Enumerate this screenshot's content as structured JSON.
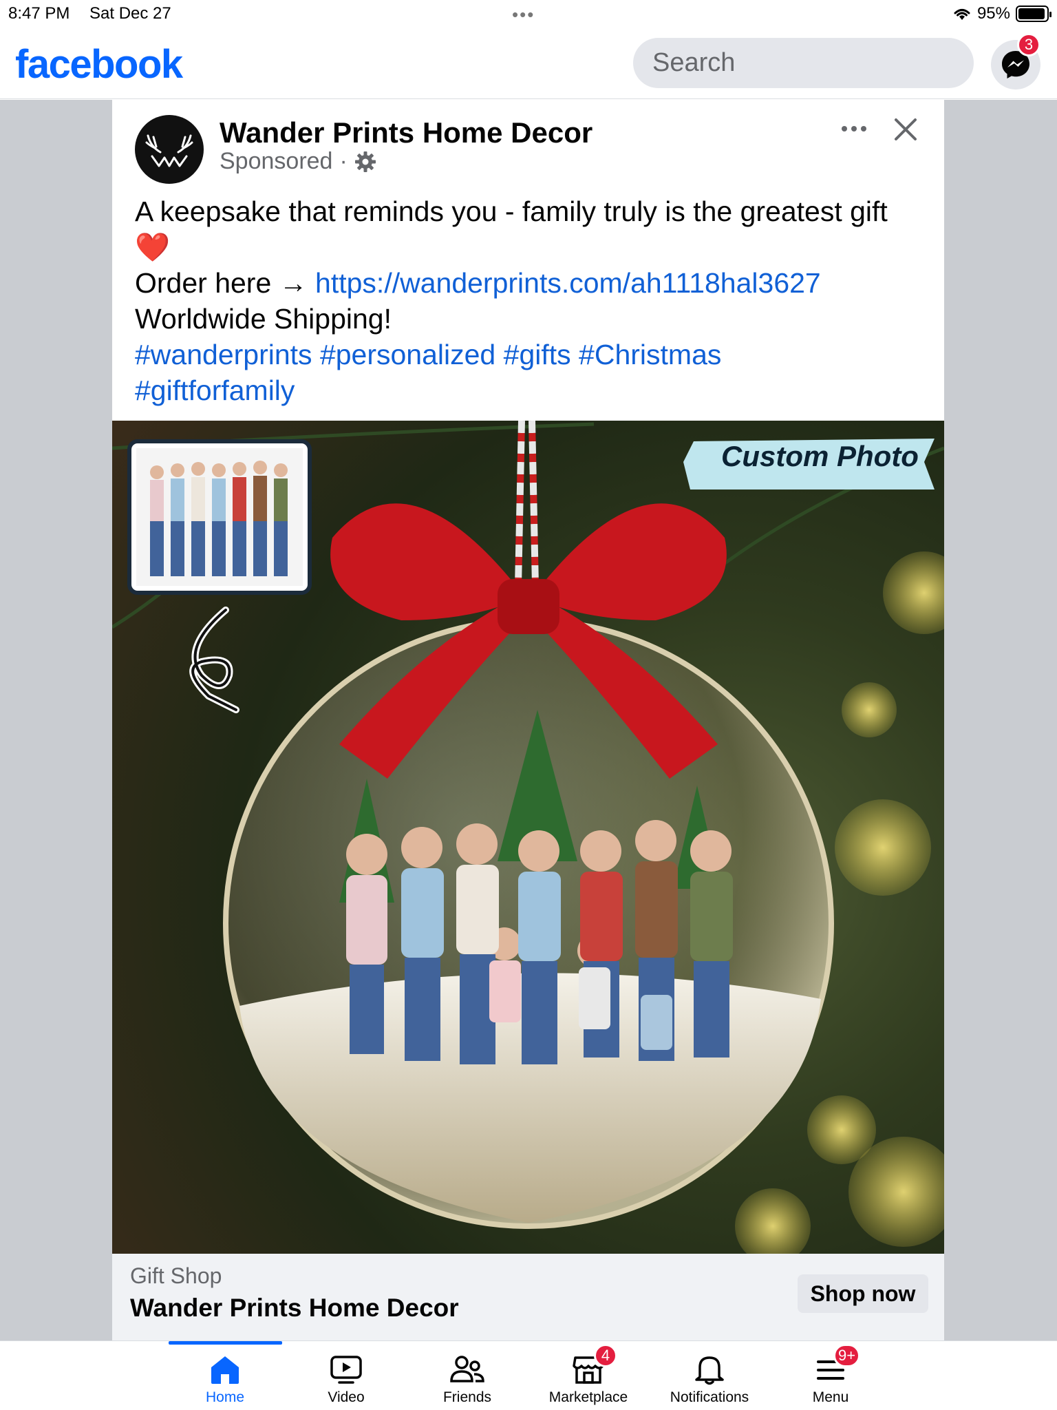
{
  "status_bar": {
    "time": "8:47 PM",
    "date": "Sat Dec 27",
    "battery": "95%",
    "battery_level": 0.95
  },
  "topbar": {
    "logo": "facebook",
    "search_placeholder": "Search",
    "messenger_badge": "3"
  },
  "post": {
    "page_name": "Wander Prints Home Decor",
    "sponsored": "Sponsored",
    "caption_line1": "A keepsake that reminds you - family truly is the greatest gift",
    "caption_emoji": "❤️",
    "order_prefix": "Order here → ",
    "order_link": "https://wanderprints.com/ah1118hal3627",
    "shipping": "Worldwide Shipping!",
    "hashtags": [
      "#wanderprints",
      "#personalized",
      "#gifts",
      "#Christmas",
      "#giftforfamily"
    ],
    "image_tag": "Custom Photo"
  },
  "cta": {
    "source": "Gift Shop",
    "title": "Wander Prints Home Decor",
    "button": "Shop now"
  },
  "tabs": [
    {
      "label": "Home",
      "icon": "home-icon",
      "active": true
    },
    {
      "label": "Video",
      "icon": "video-icon",
      "active": false
    },
    {
      "label": "Friends",
      "icon": "friends-icon",
      "active": false
    },
    {
      "label": "Marketplace",
      "icon": "marketplace-icon",
      "active": false,
      "badge": "4"
    },
    {
      "label": "Notifications",
      "icon": "bell-icon",
      "active": false
    },
    {
      "label": "Menu",
      "icon": "menu-icon",
      "active": false,
      "badge": "9+"
    }
  ],
  "colors": {
    "brand": "#0866ff",
    "link": "#1060d6",
    "badge": "#e41e3f",
    "ribbon": "#c8171e"
  }
}
